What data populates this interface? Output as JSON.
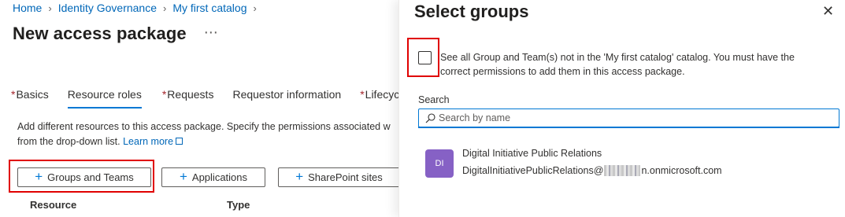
{
  "breadcrumb": [
    "Home",
    "Identity Governance",
    "My first catalog"
  ],
  "page": {
    "title": "New access package",
    "more": "⋯"
  },
  "tabs": [
    {
      "label": "Basics",
      "required": "*"
    },
    {
      "label": "Resource roles",
      "required": ""
    },
    {
      "label": "Requests",
      "required": "*"
    },
    {
      "label": "Requestor information",
      "required": ""
    },
    {
      "label": "Lifecycle",
      "required": "*"
    }
  ],
  "description": {
    "line1": "Add different resources to this access package. Specify the permissions associated w",
    "line2": "from the drop-down list.",
    "learn_more": "Learn more"
  },
  "buttons": {
    "groups": "Groups and Teams",
    "apps": "Applications",
    "sharepoint": "SharePoint sites"
  },
  "table": {
    "col_resource": "Resource",
    "col_type": "Type"
  },
  "panel": {
    "title": "Select groups",
    "checkbox_line1": "See all Group and Team(s) not in the 'My first catalog' catalog. You must have the",
    "checkbox_line2": "correct permissions to add them in this access package.",
    "search_label": "Search",
    "search_placeholder": "Search by name",
    "group": {
      "initials": "DI",
      "name": "Digital Initiative Public Relations",
      "email_prefix": "DigitalInitiativePublicRelations@",
      "email_suffix": "n.onmicrosoft.com"
    }
  },
  "colors": {
    "accent": "#0078d4",
    "highlight": "#e00000",
    "avatar": "#8661c5"
  }
}
